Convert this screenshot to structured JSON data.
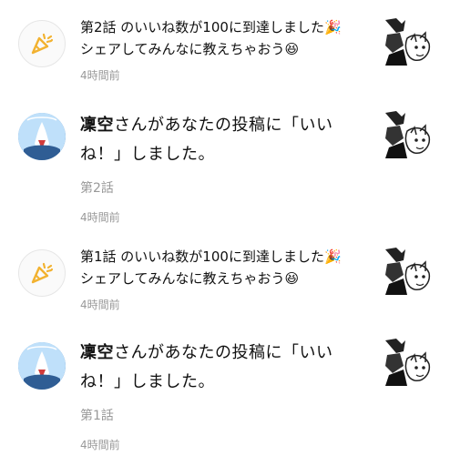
{
  "notifications": [
    {
      "type": "milestone",
      "message_line1": "第2話 のいいね数が100に到達しました🎉",
      "message_line2": "シェアしてみんなに教えちゃおう😆",
      "time": "4時間前"
    },
    {
      "type": "like",
      "user_name": "凜空",
      "message_rest": "さんがあなたの投稿に「いいね！」しました。",
      "episode": "第2話",
      "time": "4時間前"
    },
    {
      "type": "milestone",
      "message_line1": "第1話 のいいね数が100に到達しました🎉",
      "message_line2": "シェアしてみんなに教えちゃおう😆",
      "time": "4時間前"
    },
    {
      "type": "like",
      "user_name": "凜空",
      "message_rest": "さんがあなたの投稿に「いいね！」しました。",
      "episode": "第1話",
      "time": "4時間前"
    }
  ],
  "colors": {
    "text": "#111111",
    "muted": "#999999",
    "badge_accent": "#f2b230"
  },
  "icons": {
    "milestone": "party-popper-icon",
    "thumbnail": "manga-thumbnail"
  }
}
